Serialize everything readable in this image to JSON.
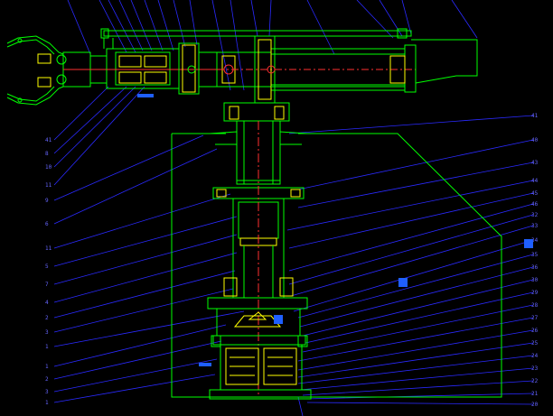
{
  "drawing": {
    "title": "",
    "colors": {
      "background": "#000000",
      "outline": "#00ff00",
      "hatch": "#ffff00",
      "leader": "#2a2aff",
      "centerline": "#ff3030",
      "marker": "#1f5fff"
    }
  },
  "balloons": {
    "left": [
      "41",
      "8",
      "10",
      "11",
      "9",
      "6",
      "11",
      "5",
      "7",
      "4",
      "2",
      "3",
      "1",
      "1",
      "2",
      "3",
      "1"
    ],
    "right": [
      "41",
      "40",
      "43",
      "44",
      "45",
      "46",
      "32",
      "33",
      "34",
      "35",
      "36",
      "30",
      "29",
      "28",
      "27",
      "26",
      "25",
      "24",
      "23",
      "22",
      "21",
      "20"
    ]
  },
  "icons": [
    "view-marker-icon"
  ]
}
